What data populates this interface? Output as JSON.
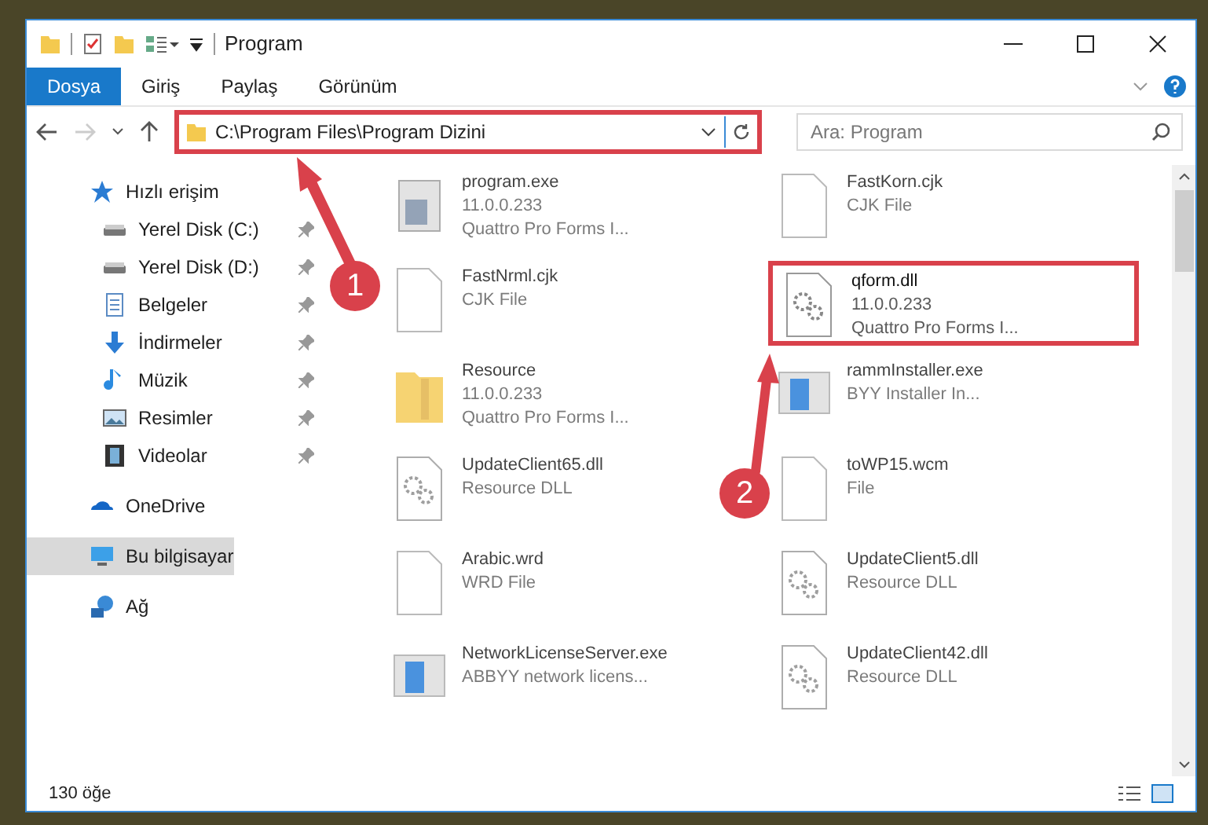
{
  "window": {
    "title": "Program"
  },
  "ribbon_tabs": [
    {
      "label": "Dosya",
      "selected": true
    },
    {
      "label": "Giriş",
      "selected": false
    },
    {
      "label": "Paylaş",
      "selected": false
    },
    {
      "label": "Görünüm",
      "selected": false
    }
  ],
  "address": {
    "path": "C:\\Program Files\\Program Dizini",
    "highlighted": true
  },
  "search": {
    "placeholder": "Ara: Program"
  },
  "sidebar": {
    "items": [
      {
        "label": "Hızlı erişim",
        "kind": "star",
        "pinned": false,
        "selected": false,
        "children": [
          {
            "label": "Yerel Disk (C:)",
            "kind": "drive",
            "pinned": true,
            "selected": false
          },
          {
            "label": "Yerel Disk (D:)",
            "kind": "drive",
            "pinned": true,
            "selected": false
          },
          {
            "label": "Belgeler",
            "kind": "document",
            "pinned": true,
            "selected": false
          },
          {
            "label": "İndirmeler",
            "kind": "download",
            "pinned": true,
            "selected": false
          },
          {
            "label": "Müzik",
            "kind": "music",
            "pinned": true,
            "selected": false
          },
          {
            "label": "Resimler",
            "kind": "picture",
            "pinned": true,
            "selected": false
          },
          {
            "label": "Videolar",
            "kind": "video",
            "pinned": true,
            "selected": false
          }
        ]
      },
      {
        "label": "OneDrive",
        "kind": "cloud",
        "pinned": false,
        "selected": false
      },
      {
        "label": "Bu bilgisayar",
        "kind": "computer",
        "pinned": false,
        "selected": true
      },
      {
        "label": "Ağ",
        "kind": "network",
        "pinned": false,
        "selected": false
      }
    ]
  },
  "files": [
    {
      "name": "program.exe",
      "details": [
        "11.0.0.233",
        "Quattro Pro Forms I..."
      ],
      "kind": "exe",
      "dimmed": true,
      "highlighted": false
    },
    {
      "name": "FastKorn.cjk",
      "details": [
        "CJK File"
      ],
      "kind": "blank",
      "dimmed": true,
      "highlighted": false
    },
    {
      "name": "FastNrml.cjk",
      "details": [
        "CJK File"
      ],
      "kind": "blank",
      "dimmed": true,
      "highlighted": false
    },
    {
      "name": "qform.dll",
      "details": [
        "11.0.0.233",
        "Quattro Pro Forms I..."
      ],
      "kind": "dll",
      "dimmed": false,
      "highlighted": true
    },
    {
      "name": "Resource",
      "details": [
        "11.0.0.233",
        "Quattro Pro Forms I..."
      ],
      "kind": "folder",
      "dimmed": true,
      "highlighted": false
    },
    {
      "name": "rammInstaller.exe",
      "details": [
        "BYY Installer In..."
      ],
      "kind": "app",
      "dimmed": true,
      "highlighted": false
    },
    {
      "name": "UpdateClient65.dll",
      "details": [
        "Resource DLL"
      ],
      "kind": "dll",
      "dimmed": true,
      "highlighted": false
    },
    {
      "name": "toWP15.wcm",
      "details": [
        "File"
      ],
      "kind": "blank",
      "dimmed": true,
      "highlighted": false
    },
    {
      "name": "Arabic.wrd",
      "details": [
        "WRD File"
      ],
      "kind": "blank",
      "dimmed": true,
      "highlighted": false
    },
    {
      "name": "UpdateClient5.dll",
      "details": [
        "Resource DLL"
      ],
      "kind": "dll",
      "dimmed": true,
      "highlighted": false
    },
    {
      "name": "NetworkLicenseServer.exe",
      "details": [
        "ABBYY network licens..."
      ],
      "kind": "app",
      "dimmed": true,
      "highlighted": false
    },
    {
      "name": "UpdateClient42.dll",
      "details": [
        "Resource DLL"
      ],
      "kind": "dll",
      "dimmed": true,
      "highlighted": false
    }
  ],
  "annotations": [
    {
      "label": "1"
    },
    {
      "label": "2"
    }
  ],
  "status_bar": {
    "count": "130 öğe"
  }
}
